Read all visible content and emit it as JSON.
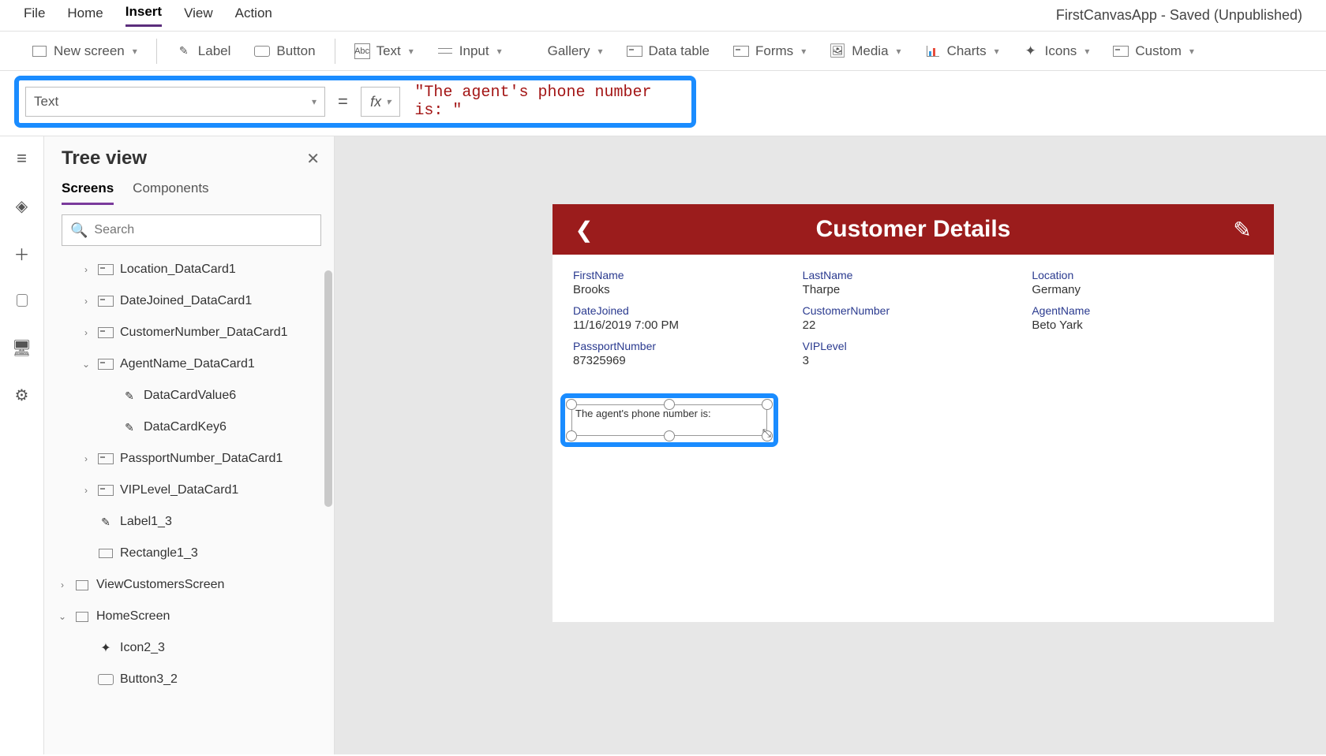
{
  "menubar": {
    "items": [
      "File",
      "Home",
      "Insert",
      "View",
      "Action"
    ],
    "active_index": 2,
    "app_status": "FirstCanvasApp - Saved (Unpublished)"
  },
  "ribbon": {
    "new_screen": "New screen",
    "label": "Label",
    "button": "Button",
    "text": "Text",
    "input": "Input",
    "gallery": "Gallery",
    "data_table": "Data table",
    "forms": "Forms",
    "media": "Media",
    "charts": "Charts",
    "icons": "Icons",
    "custom": "Custom"
  },
  "formula": {
    "property": "Text",
    "equals": "=",
    "fx": "fx",
    "value": "\"The agent's phone number is: \""
  },
  "tree": {
    "title": "Tree view",
    "tabs": {
      "screens": "Screens",
      "components": "Components"
    },
    "search_placeholder": "Search",
    "nodes": {
      "n0": "Location_DataCard1",
      "n1": "DateJoined_DataCard1",
      "n2": "CustomerNumber_DataCard1",
      "n3": "AgentName_DataCard1",
      "n3a": "DataCardValue6",
      "n3b": "DataCardKey6",
      "n4": "PassportNumber_DataCard1",
      "n5": "VIPLevel_DataCard1",
      "n6": "Label1_3",
      "n7": "Rectangle1_3",
      "n8": "ViewCustomersScreen",
      "n9": "HomeScreen",
      "n9a": "Icon2_3",
      "n9b": "Button3_2"
    }
  },
  "phone": {
    "title": "Customer Details",
    "fields": {
      "first_name": {
        "label": "FirstName",
        "value": "Brooks"
      },
      "last_name": {
        "label": "LastName",
        "value": "Tharpe"
      },
      "location": {
        "label": "Location",
        "value": "Germany"
      },
      "date_joined": {
        "label": "DateJoined",
        "value": "11/16/2019 7:00 PM"
      },
      "customer_number": {
        "label": "CustomerNumber",
        "value": "22"
      },
      "agent_name": {
        "label": "AgentName",
        "value": "Beto Yark"
      },
      "passport": {
        "label": "PassportNumber",
        "value": "87325969"
      },
      "vip": {
        "label": "VIPLevel",
        "value": "3"
      }
    },
    "selected_label": "The agent's phone number is:"
  }
}
